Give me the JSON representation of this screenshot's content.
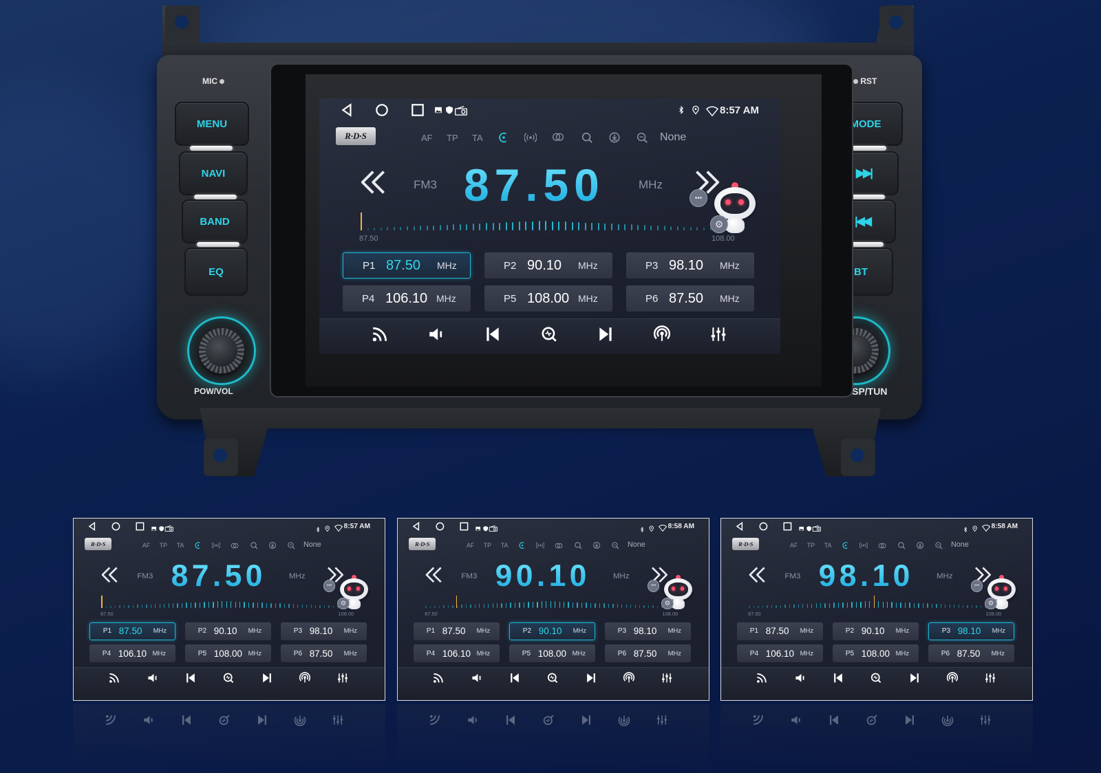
{
  "head_unit": {
    "mic_label": "MIC",
    "rst_label": "RST",
    "left_buttons": [
      {
        "label": "MENU"
      },
      {
        "label": "NAVI"
      },
      {
        "label": "BAND"
      },
      {
        "label": "EQ"
      }
    ],
    "right_buttons": [
      {
        "label": "MODE"
      },
      {
        "label": "▶▶|",
        "icon": "next-track-icon"
      },
      {
        "label": "|◀◀",
        "icon": "previous-track-icon"
      },
      {
        "label": "BT"
      }
    ],
    "left_knob_label": "POW/VOL",
    "right_knob_label": "ASP/TUN",
    "accent_color": "#2ed3e8"
  },
  "main_screen": {
    "status_bar": {
      "nav_icons": [
        "back-icon",
        "home-icon",
        "recents-icon"
      ],
      "notification_icons": [
        "image-icon",
        "shield-icon",
        "radio-icon"
      ],
      "right_icons": [
        "bluetooth-icon",
        "location-icon",
        "wifi-icon"
      ],
      "time": "8:57 AM"
    },
    "rds_label": "R·D·S",
    "options": {
      "af": "AF",
      "tp": "TP",
      "ta": "TA",
      "pty_value": "None"
    },
    "band": "FM3",
    "frequency": "87.50",
    "unit": "MHz",
    "scale_min": "87.50",
    "scale_max": "108.00",
    "tuning_position": 0.0,
    "presets": [
      {
        "label": "P1",
        "value": "87.50",
        "unit": "MHz",
        "selected": true
      },
      {
        "label": "P2",
        "value": "90.10",
        "unit": "MHz",
        "selected": false
      },
      {
        "label": "P3",
        "value": "98.10",
        "unit": "MHz",
        "selected": false
      },
      {
        "label": "P4",
        "value": "106.10",
        "unit": "MHz",
        "selected": false
      },
      {
        "label": "P5",
        "value": "108.00",
        "unit": "MHz",
        "selected": false
      },
      {
        "label": "P6",
        "value": "87.50",
        "unit": "MHz",
        "selected": false
      }
    ],
    "bottom_bar_icons": [
      "rss-icon",
      "speaker-icon",
      "skip-previous-icon",
      "search-icon",
      "skip-next-icon",
      "broadcast-icon",
      "equalizer-icon"
    ]
  },
  "thumbnails": [
    {
      "time": "8:57 AM",
      "frequency": "87.50",
      "selected_preset": 0,
      "tuning_position": 0.0
    },
    {
      "time": "8:58 AM",
      "frequency": "90.10",
      "selected_preset": 1,
      "tuning_position": 0.127
    },
    {
      "time": "8:58 AM",
      "frequency": "98.10",
      "selected_preset": 2,
      "tuning_position": 0.517
    }
  ],
  "colors": {
    "frequency_cyan": "#2fd6ea",
    "tick_color": "#27bfd6",
    "tuning_marker": "#f2b33a",
    "screen_bg": "#1d2130"
  }
}
